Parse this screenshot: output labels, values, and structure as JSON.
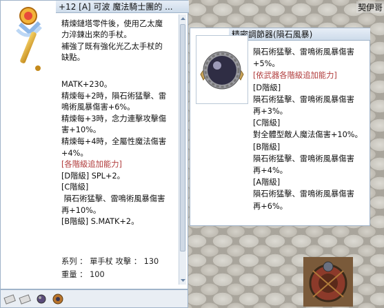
{
  "corner_label": "契伊哥",
  "left_window": {
    "title": "+12 [A] 可波 魔法騎士團的 ...",
    "description": [
      "精煉鏈塔零件後，使用乙太魔",
      "力淬鍊出來的手杖。",
      "補強了既有強化光乙太手杖的",
      "缺點。"
    ],
    "stats": [
      {
        "text": "MATK+230。",
        "red": false
      },
      {
        "text": "精煉每+2時，隕石術猛擊、雷",
        "red": false
      },
      {
        "text": "鳴術風暴傷害+6%。",
        "red": false
      },
      {
        "text": "精煉每+3時，念力連擊攻擊傷",
        "red": false
      },
      {
        "text": "害+10%。",
        "red": false
      },
      {
        "text": "精煉每+4時，全屬性魔法傷害",
        "red": false
      },
      {
        "text": "+4%。",
        "red": false
      },
      {
        "text": "[各階級追加能力]",
        "red": true
      },
      {
        "text": "[D階級] SPL+2。",
        "red": false
      },
      {
        "text": "[C階級]",
        "red": false
      },
      {
        "text": " 隕石術猛擊、雷鳴術風暴傷害",
        "red": false
      },
      {
        "text": "再+10%。",
        "red": false
      },
      {
        "text": "[B階級] S.MATK+2。",
        "red": false
      }
    ],
    "footer": {
      "line1": "系列 ： 單手杖  攻擊 ： 130",
      "line2": "重量 ： 100"
    }
  },
  "right_window": {
    "title": "精密調節器(隕石風暴)",
    "lines": [
      {
        "text": "隕石術猛擊、雷鳴術風暴傷害",
        "red": false
      },
      {
        "text": "+5%。",
        "red": false
      },
      {
        "text": "[依武器各階級追加能力]",
        "red": true
      },
      {
        "text": "[D階級]",
        "red": false
      },
      {
        "text": "隕石術猛擊、雷鳴術風暴傷害",
        "red": false
      },
      {
        "text": "再+3%。",
        "red": false
      },
      {
        "text": "[C階級]",
        "red": false
      },
      {
        "text": "對全體型敵人魔法傷害+10%。",
        "red": false
      },
      {
        "text": "[B階級]",
        "red": false
      },
      {
        "text": "隕石術猛擊、雷鳴術風暴傷害",
        "red": false
      },
      {
        "text": "再+4%。",
        "red": false
      },
      {
        "text": "[A階級]",
        "red": false
      },
      {
        "text": "隕石術猛擊、雷鳴術風暴傷害",
        "red": false
      },
      {
        "text": "再+6%。",
        "red": false
      }
    ]
  },
  "colors": {
    "window_border": "#9fb3c9",
    "title_bar": "#cddbea",
    "highlight_red": "#b03a3a"
  }
}
